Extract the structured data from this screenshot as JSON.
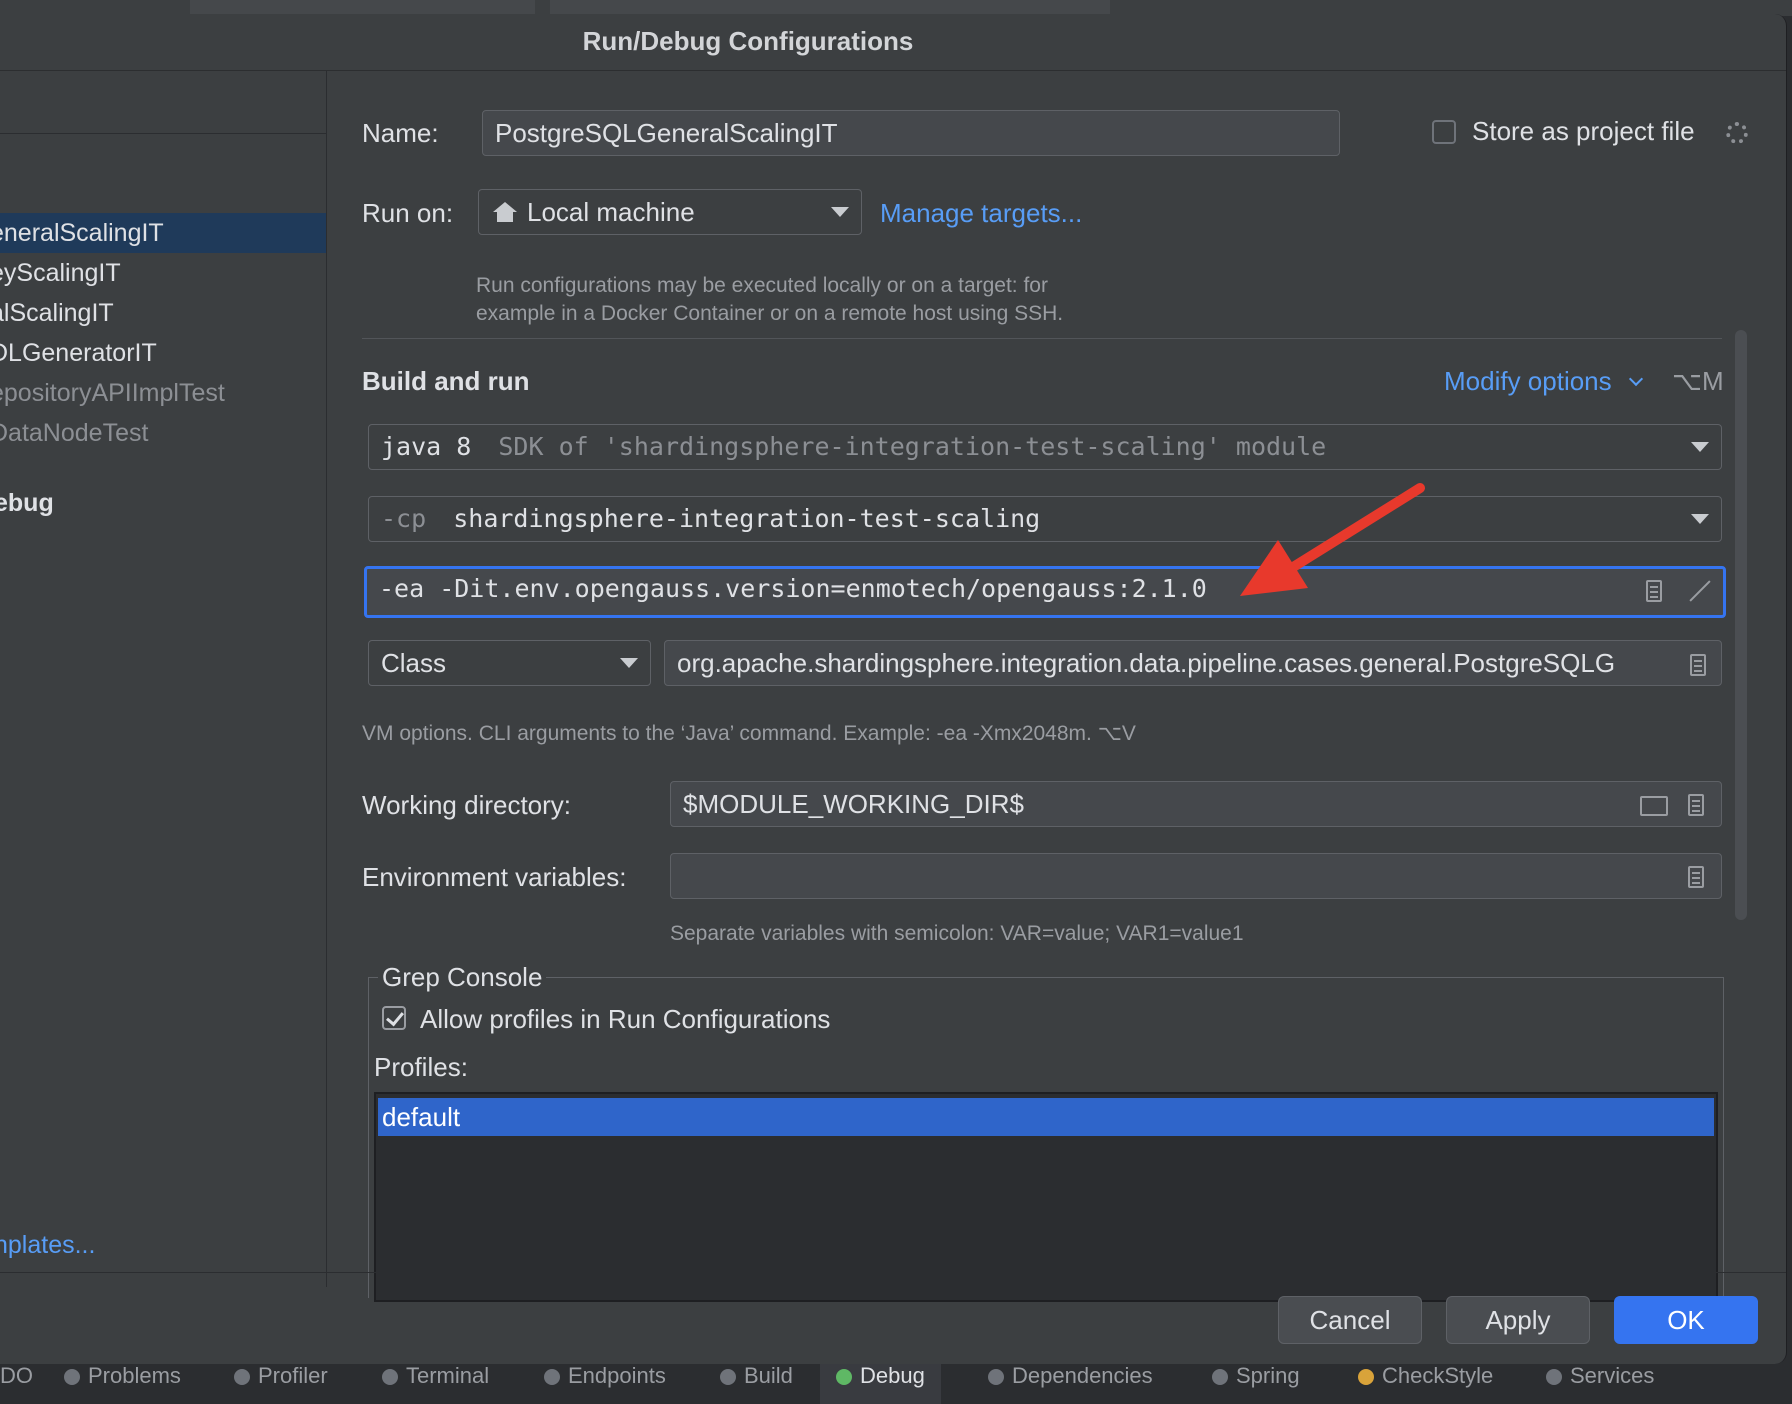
{
  "dialog": {
    "title": "Run/Debug Configurations"
  },
  "sidebar": {
    "items": [
      {
        "label": "eneralScalingIT",
        "selected": true
      },
      {
        "label": "eyScalingIT"
      },
      {
        "label": "alScalingIT"
      },
      {
        "label": "DLGeneratorIT"
      },
      {
        "label": "epositoryAPIImplTest"
      },
      {
        "label": "DataNodeTest"
      }
    ],
    "group_label": "ebug",
    "templates_link": "nplates..."
  },
  "form": {
    "name_label": "Name:",
    "name_value": "PostgreSQLGeneralScalingIT",
    "store_label": "Store as project file",
    "store_checked": false,
    "run_on_label": "Run on:",
    "run_on_value": "Local machine",
    "manage_targets": "Manage targets...",
    "run_on_hint_line1": "Run configurations may be executed locally or on a target: for",
    "run_on_hint_line2": "example in a Docker Container or on a remote host using SSH.",
    "build_and_run": "Build and run",
    "modify_options": "Modify options",
    "modify_options_shortcut": "⌥M",
    "sdk_prefix": "java 8",
    "sdk_suffix": "SDK of 'shardingsphere-integration-test-scaling' module",
    "cp_prefix": "-cp",
    "cp_value": "shardingsphere-integration-test-scaling",
    "vm_options": "-ea -Dit.env.opengauss.version=enmotech/opengauss:2.1.0",
    "kind_value": "Class",
    "class_value": "org.apache.shardingsphere.integration.data.pipeline.cases.general.PostgreSQLG",
    "vm_hint": "VM options. CLI arguments to the ‘Java’ command. Example: -ea -Xmx2048m. ⌥V",
    "workdir_label": "Working directory:",
    "workdir_value": "$MODULE_WORKING_DIR$",
    "env_label": "Environment variables:",
    "env_value": "",
    "env_hint": "Separate variables with semicolon: VAR=value; VAR1=value1"
  },
  "grep": {
    "title": "Grep Console",
    "allow_label": "Allow profiles in Run Configurations",
    "allow_checked": true,
    "profiles_label": "Profiles:",
    "profiles": [
      "default"
    ]
  },
  "buttons": {
    "cancel": "Cancel",
    "apply": "Apply",
    "ok": "OK"
  },
  "statusbar": {
    "items": [
      "DO",
      "Problems",
      "Profiler",
      "Terminal",
      "Endpoints",
      "Build",
      "Debug",
      "Dependencies",
      "Spring",
      "CheckStyle",
      "Services"
    ],
    "active": "Debug"
  },
  "colors": {
    "accent": "#3574f0",
    "link": "#589df6",
    "arrow": "#e8392c"
  }
}
